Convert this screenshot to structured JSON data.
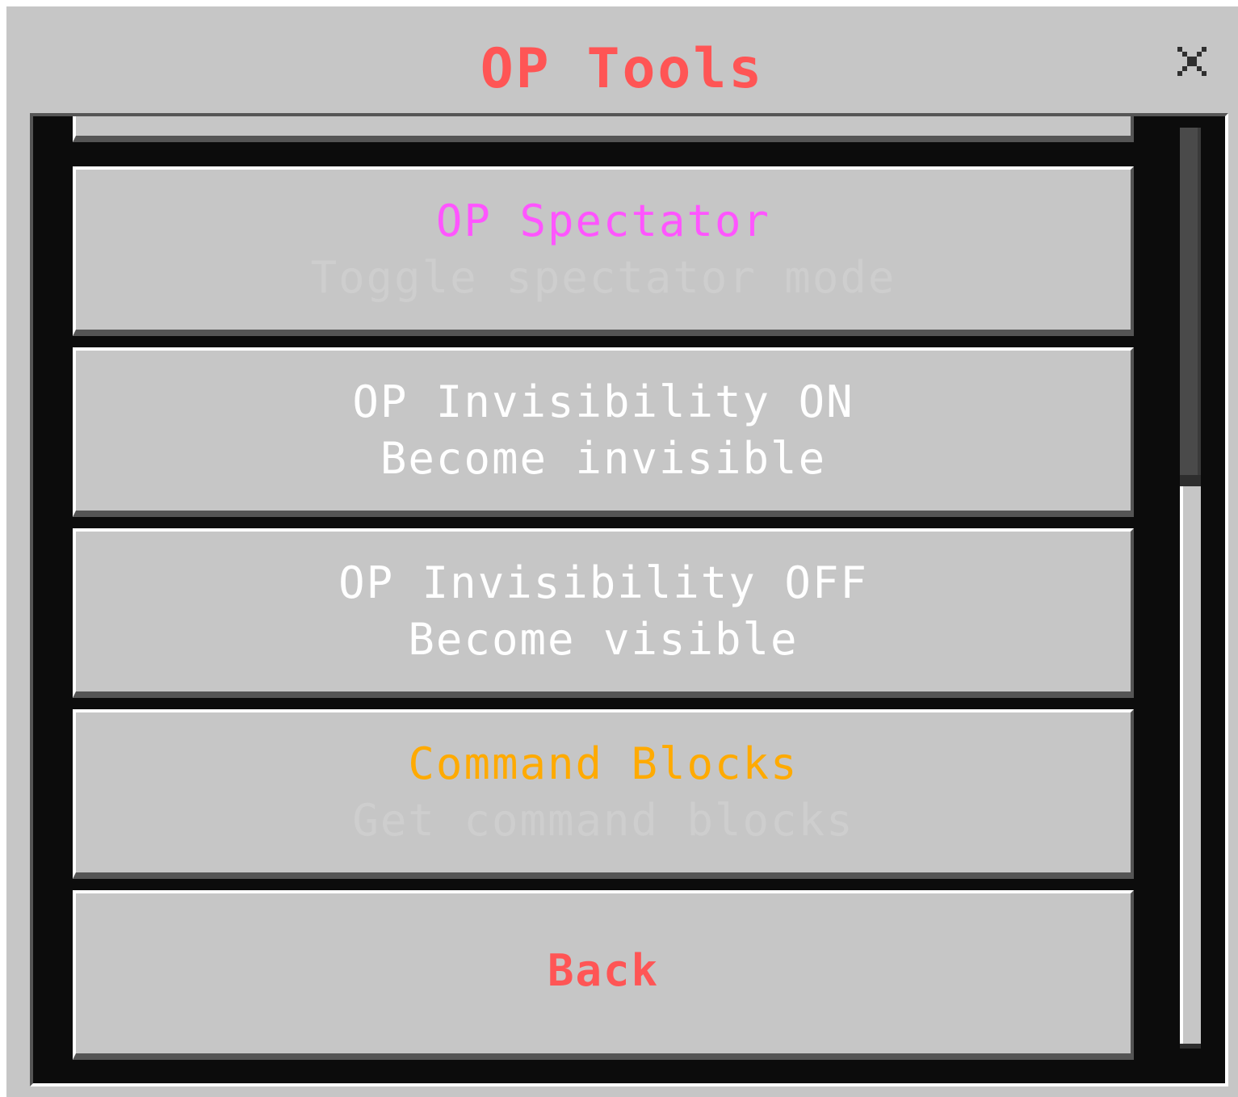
{
  "dialog": {
    "title": "OP Tools",
    "title_color": "#ff5555",
    "close_glyph": "×"
  },
  "scrollbar": {
    "position_fraction": 1.0
  },
  "buttons": [
    {
      "id": "partial",
      "title": "",
      "subtitle": ""
    },
    {
      "id": "op-spectator",
      "title": "OP Spectator",
      "title_color": "#ff55ff",
      "subtitle": "Toggle spectator mode",
      "subtitle_color": "#cecece"
    },
    {
      "id": "op-invis-on",
      "title": "OP Invisibility ON",
      "title_color": "#ffffff",
      "subtitle": "Become invisible",
      "subtitle_color": "#ffffff"
    },
    {
      "id": "op-invis-off",
      "title": "OP Invisibility OFF",
      "title_color": "#ffffff",
      "subtitle": "Become visible",
      "subtitle_color": "#ffffff"
    },
    {
      "id": "command-blocks",
      "title": "Command Blocks",
      "title_color": "#ffaa00",
      "subtitle": "Get command blocks",
      "subtitle_color": "#cecece"
    },
    {
      "id": "back",
      "title": "Back",
      "title_color": "#ff5555"
    }
  ],
  "icons": {
    "close": "close-icon"
  }
}
